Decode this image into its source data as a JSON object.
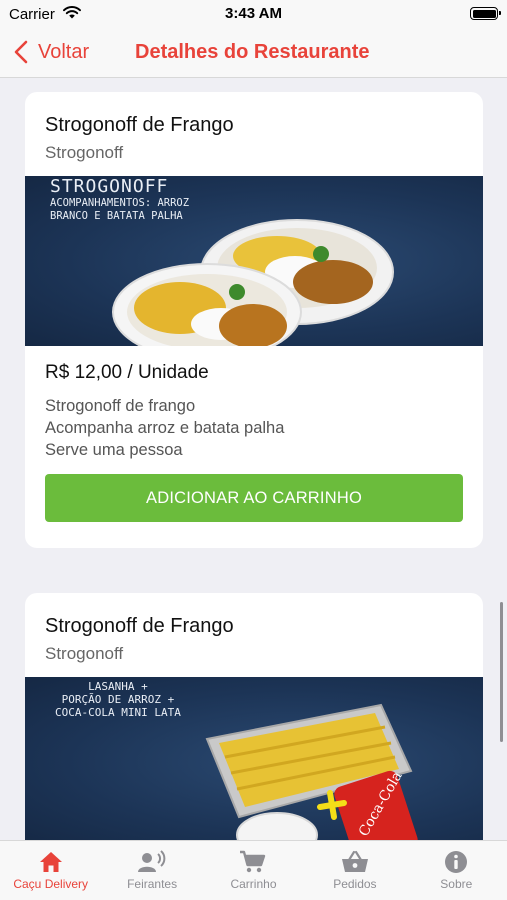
{
  "status_bar": {
    "carrier": "Carrier",
    "time": "3:43 AM"
  },
  "nav": {
    "back_label": "Voltar",
    "title": "Detalhes do Restaurante",
    "accent_color": "#e8433a"
  },
  "items": [
    {
      "name": "Strogonoff de Frango",
      "category": "Strogonoff",
      "image_caption": [
        "STROGONOFF",
        "ACOMPANHAMENTOS: ARROZ",
        "BRANCO E BATATA PALHA"
      ],
      "price": "R$ 12,00 / Unidade",
      "description": [
        "Strogonoff de frango",
        "Acompanha arroz e batata palha",
        "Serve uma pessoa"
      ],
      "button_label": "ADICIONAR AO CARRINHO",
      "button_color": "#6bbc3c"
    },
    {
      "name": "Strogonoff de Frango",
      "category": "Strogonoff",
      "image_caption": [
        "LASANHA +",
        "PORÇÃO DE ARROZ +",
        "COCA-COLA MINI LATA"
      ]
    }
  ],
  "tab_bar": {
    "tabs": [
      {
        "label": "Caçu Delivery",
        "icon": "home-icon",
        "active": true
      },
      {
        "label": "Feirantes",
        "icon": "vendor-speaking-icon",
        "active": false
      },
      {
        "label": "Carrinho",
        "icon": "cart-icon",
        "active": false
      },
      {
        "label": "Pedidos",
        "icon": "basket-icon",
        "active": false
      },
      {
        "label": "Sobre",
        "icon": "info-icon",
        "active": false
      }
    ]
  }
}
